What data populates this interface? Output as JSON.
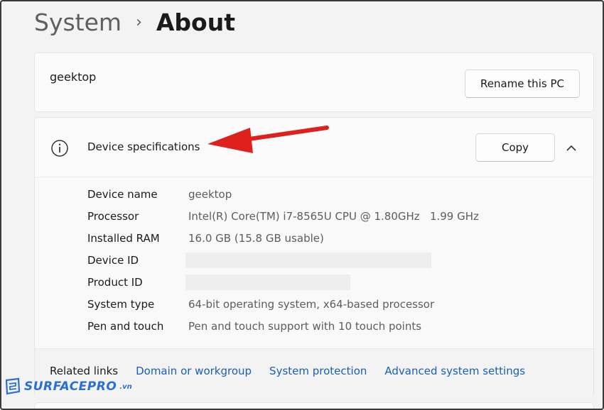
{
  "breadcrumb": {
    "parent": "System",
    "separator": "›",
    "current": "About"
  },
  "pc": {
    "name": "geektop",
    "rename_label": "Rename this PC"
  },
  "device_specs": {
    "icon": "info-icon",
    "title": "Device specifications",
    "copy_label": "Copy",
    "toggle_icon": "chevron-up-icon",
    "rows": [
      {
        "label": "Device name",
        "value": "geektop"
      },
      {
        "label": "Processor",
        "value": "Intel(R) Core(TM) i7-8565U CPU @ 1.80GHz   1.99 GHz"
      },
      {
        "label": "Installed RAM",
        "value": "16.0 GB (15.8 GB usable)"
      },
      {
        "label": "Device ID",
        "value": ""
      },
      {
        "label": "Product ID",
        "value": ""
      },
      {
        "label": "System type",
        "value": "64-bit operating system, x64-based processor"
      },
      {
        "label": "Pen and touch",
        "value": "Pen and touch support with 10 touch points"
      }
    ]
  },
  "related": {
    "label": "Related links",
    "links": [
      "Domain or workgroup",
      "System protection",
      "Advanced system settings"
    ]
  },
  "annotation": {
    "arrow_color": "#e0201c"
  },
  "watermark": {
    "text": "SURFACEPRO",
    "suffix": ".vn",
    "color": "#2a6fd6"
  }
}
